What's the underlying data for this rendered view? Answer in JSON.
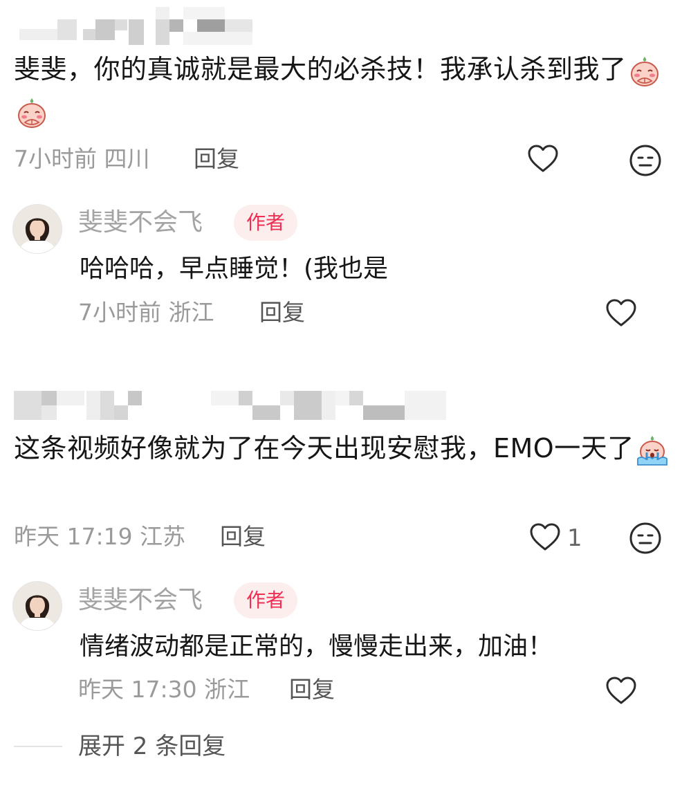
{
  "comments": [
    {
      "text": "斐斐，你的真诚就是最大的必杀技！我承认杀到我了",
      "emojis": [
        "peach-blush-emoji",
        "peach-blush-emoji"
      ],
      "time": "7小时前",
      "location": "四川",
      "reply_label": "回复",
      "like_count": "",
      "reply": {
        "author": "斐斐不会飞",
        "badge": "作者",
        "text": "哈哈哈，早点睡觉！(我也是",
        "time": "7小时前",
        "location": "浙江",
        "reply_label": "回复"
      }
    },
    {
      "text": "这条视频好像就为了在今天出现安慰我，EMO一天了",
      "emojis": [
        "peach-crying-emoji"
      ],
      "time": "昨天 17:19",
      "location": "江苏",
      "reply_label": "回复",
      "like_count": "1",
      "reply": {
        "author": "斐斐不会飞",
        "badge": "作者",
        "text": "情绪波动都是正常的，慢慢走出来，加油！",
        "time": "昨天 17:30",
        "location": "浙江",
        "reply_label": "回复"
      }
    }
  ],
  "expand_label": "展开 2 条回复",
  "colors": {
    "accent": "#ee2e52",
    "badge_bg": "#fdeeee",
    "meta_gray": "#9a9a9a"
  }
}
